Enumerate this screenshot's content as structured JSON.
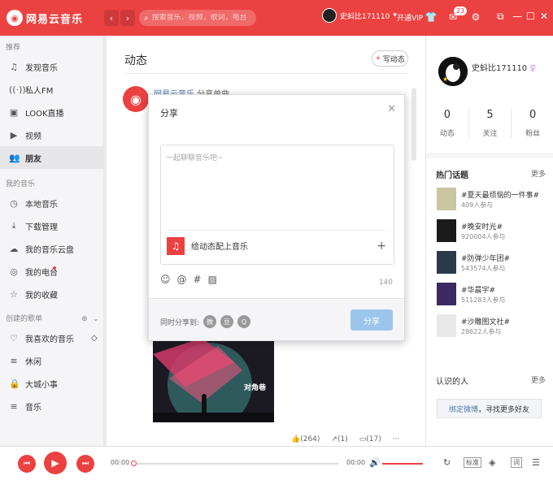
{
  "app": {
    "name": "网易云音乐"
  },
  "search": {
    "placeholder": "搜索音乐，视频，歌词，电台"
  },
  "top": {
    "username": "史蚪比171110",
    "vip": "开通VIP",
    "msg_count": "23"
  },
  "sidebar": {
    "section1": "推荐",
    "items1": [
      "发现音乐",
      "私人FM",
      "LOOK直播",
      "视频",
      "朋友"
    ],
    "section2": "我的音乐",
    "items2": [
      "本地音乐",
      "下载管理",
      "我的音乐云盘",
      "我的电台",
      "我的收藏"
    ],
    "section3": "创建的歌单",
    "items3": [
      "我喜欢的音乐",
      "休闲",
      "大城小事",
      "音乐"
    ]
  },
  "main": {
    "title": "动态",
    "write": "写动态",
    "post_name": "网易云音乐",
    "post_suffix": "分享单曲",
    "album_text": "对角巷",
    "likes": "(264)",
    "shares": "(1)",
    "comments": "(17)",
    "more": "···"
  },
  "dialog": {
    "title": "分享",
    "placeholder": "一起聊聊音乐吧~",
    "music_label": "给动态配上音乐",
    "count": "140",
    "share_to": "同时分享到:",
    "submit": "分享"
  },
  "right": {
    "name": "史蚪比171110",
    "stats": [
      {
        "n": "0",
        "l": "动态"
      },
      {
        "n": "5",
        "l": "关注"
      },
      {
        "n": "0",
        "l": "粉丝"
      }
    ],
    "hot": "热门话题",
    "more": "更多",
    "topics": [
      {
        "t": "#夏天最烦恼的一件事#",
        "c": "409人参与"
      },
      {
        "t": "#晚安时光#",
        "c": "920004人参与"
      },
      {
        "t": "#防弹少年团#",
        "c": "543574人参与"
      },
      {
        "t": "#华晨宇#",
        "c": "511283人参与"
      },
      {
        "t": "#沙雕图文社#",
        "c": "28622人参与"
      }
    ],
    "known": "认识的人",
    "bind_a": "绑定微博",
    "bind_b": "，寻找更多好友"
  },
  "player": {
    "cur": "00:00",
    "total": "00:00",
    "quality": "标准",
    "lyric": "词"
  },
  "colors": {
    "brand": "#ec4141",
    "submit": "#9cc5ec"
  }
}
